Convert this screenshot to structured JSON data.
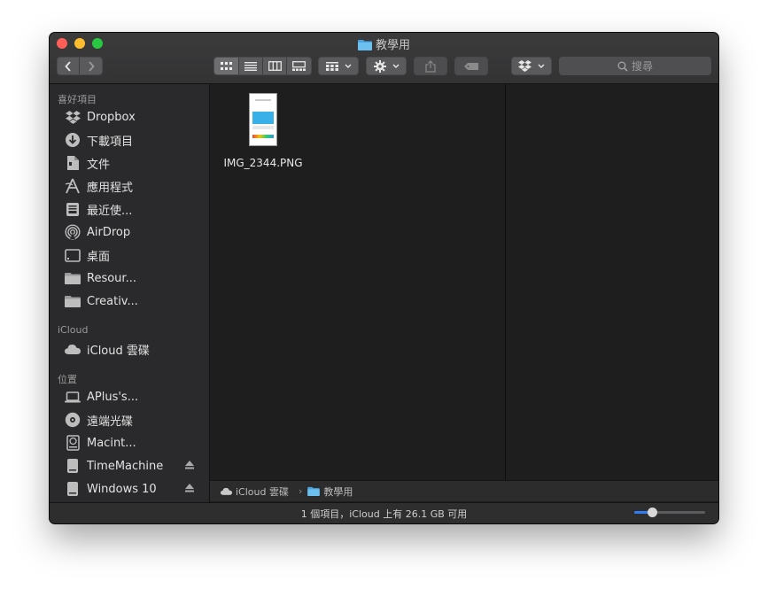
{
  "window": {
    "title": "教學用"
  },
  "toolbar": {
    "search_placeholder": "搜尋"
  },
  "sidebar": {
    "sections": {
      "favorites": "喜好項目",
      "icloud": "iCloud",
      "locations": "位置"
    },
    "favorites": [
      {
        "label": "Dropbox",
        "icon": "dropbox-icon"
      },
      {
        "label": "下載項目",
        "icon": "download-icon"
      },
      {
        "label": "文件",
        "icon": "document-icon"
      },
      {
        "label": "應用程式",
        "icon": "applications-icon"
      },
      {
        "label": "最近使...",
        "icon": "recents-icon"
      },
      {
        "label": "AirDrop",
        "icon": "airdrop-icon"
      },
      {
        "label": "桌面",
        "icon": "desktop-icon"
      },
      {
        "label": "Resour...",
        "icon": "folder-icon"
      },
      {
        "label": "Creativ...",
        "icon": "folder-icon"
      }
    ],
    "icloud_items": [
      {
        "label": "iCloud 雲碟",
        "icon": "cloud-icon"
      }
    ],
    "locations": [
      {
        "label": "APlus's...",
        "icon": "laptop-icon"
      },
      {
        "label": "遠端光碟",
        "icon": "disc-icon"
      },
      {
        "label": "Macint...",
        "icon": "hard-drive-icon"
      },
      {
        "label": "TimeMachine",
        "icon": "external-drive-icon",
        "eject": true
      },
      {
        "label": "Windows 10",
        "icon": "external-drive-icon",
        "eject": true
      }
    ]
  },
  "files": [
    {
      "name": "IMG_2344.PNG"
    }
  ],
  "pathbar": {
    "items": [
      "iCloud 雲碟",
      "教學用"
    ]
  },
  "status": {
    "text": "1 個項目，iCloud 上有 26.1 GB 可用"
  },
  "icon_size_slider": {
    "value": 0.25
  },
  "colors": {
    "accent": "#2f7cf6",
    "close": "#ff5f57",
    "minimize": "#febc2e",
    "maximize": "#28c840",
    "folder": "#4aa3df"
  }
}
